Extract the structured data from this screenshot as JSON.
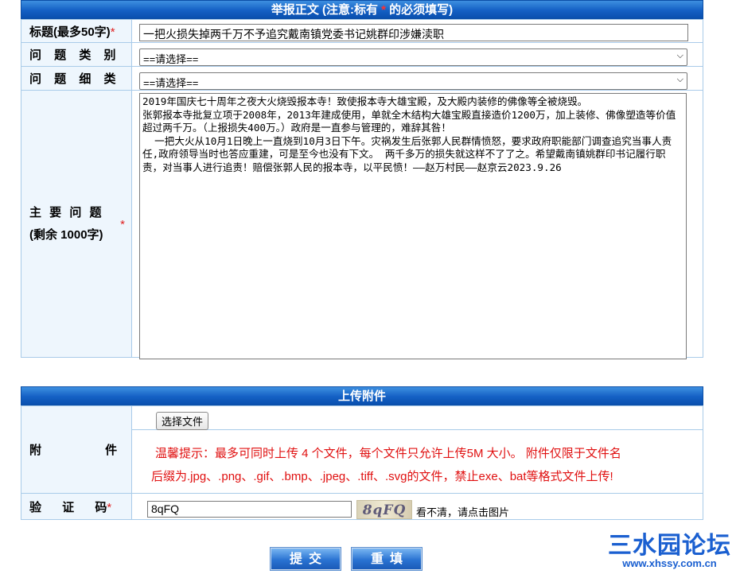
{
  "report": {
    "header_prefix": "举报正文 (注意:标有",
    "header_star": "*",
    "header_suffix": "的必须填写)",
    "title_label": "标题(最多50字)",
    "required_mark": "*",
    "title_value": "一把火损失掉两千万不予追究戴南镇党委书记姚群印涉嫌渎职",
    "category_label": "问 题 类 别",
    "category_value": "==请选择==",
    "subcategory_label": "问 题 细 类",
    "subcategory_value": "==请选择==",
    "main_label_line1": "主 要 问 题",
    "main_label_line2": "(剩余 1000字)",
    "main_text": "2019年国庆七十周年之夜大火烧毁报本寺！致使报本寺大雄宝殿，及大殿内装修的佛像等全被烧毁。\n张郭报本寺批复立项于2008年，2013年建成使用，单就全木结构大雄宝殿直接造价1200万，加上装修、佛像塑造等价值超过两千万。（上报损失400万。）政府是一直参与管理的，难辞其咎！\n  一把大火从10月1日晚上一直烧到10月3日下午。灾祸发生后张郭人民群情愤怒，要求政府职能部门调查追究当事人责任,政府领导当时也答应重建，可是至今也没有下文。 两千多万的损失就这样不了了之。希望戴南镇姚群印书记履行职责，对当事人进行追责！赔偿张郭人民的报本寺，以平民愤！——赵万村民——赵京云2023.9.26"
  },
  "upload": {
    "header": "上传附件",
    "attach_label": "附 件",
    "choose_file_button": "选择文件",
    "tip_line1": "温馨提示：最多可同时上传 4 个文件，每个文件只允许上传5M 大小。 附件仅限于文件名",
    "tip_line2": "后缀为.jpg、.png、.gif、.bmp、.jpeg、.tiff、.svg的文件，禁止exe、bat等格式文件上传!",
    "captcha_label": "验 证 码",
    "captcha_value": "8qFQ",
    "captcha_image_text": "8qFQ",
    "captcha_hint": "看不清，请点击图片"
  },
  "actions": {
    "submit_label": "提交",
    "reset_label": "重填"
  },
  "watermark": {
    "brand": "三水园论坛",
    "url": "www.xhssy.com.cn"
  },
  "icons": {
    "select_chevron": "chevron-down-icon"
  }
}
